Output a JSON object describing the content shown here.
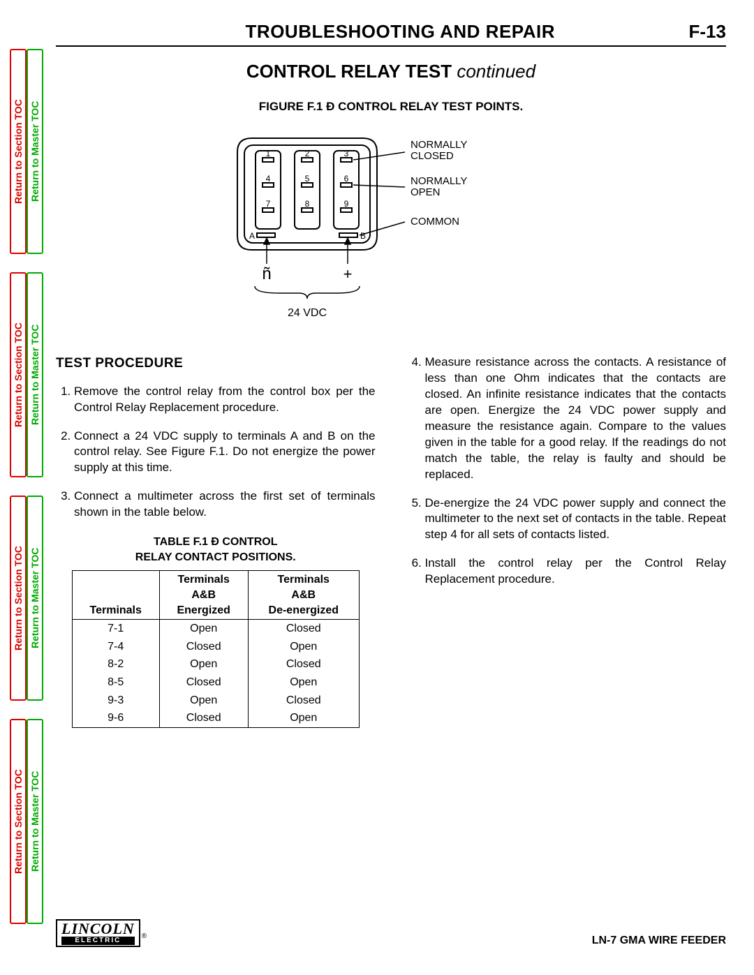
{
  "sidebar": {
    "section_toc": "Return to Section TOC",
    "master_toc": "Return to Master TOC"
  },
  "header": {
    "title": "TROUBLESHOOTING AND REPAIR",
    "page": "F-13"
  },
  "subtitle": {
    "main": "CONTROL RELAY TEST",
    "cont": "continued"
  },
  "figure": {
    "caption": "FIGURE F.1 Ð CONTROL RELAY TEST POINTS.",
    "labels": {
      "nc": "NORMALLY CLOSED",
      "no": "NORMALLY OPEN",
      "common": "COMMON",
      "a": "A",
      "b": "B",
      "minus": "ñ",
      "plus": "+",
      "vdc": "24  VDC",
      "pins": [
        "1",
        "2",
        "3",
        "4",
        "5",
        "6",
        "7",
        "8",
        "9"
      ]
    }
  },
  "procedure": {
    "heading": "TEST PROCEDURE",
    "steps_left": [
      "Remove the control relay from the control box per the Control Relay Replacement procedure.",
      "Connect a 24 VDC supply to terminals A and  B on the control relay. See Figure F.1. Do not energize the power supply at this time.",
      "Connect a multimeter across the first set of terminals shown in the table below."
    ],
    "steps_right": [
      "Measure resistance across the contacts. A resistance of less than one Ohm indicates that the contacts are closed. An infinite resistance indicates that the contacts are open. Energize the 24 VDC power supply and measure the resistance again. Compare to the values given in the table for a good relay. If the readings do not match the table, the relay is faulty and should be replaced.",
      "De-energize the 24 VDC power supply and connect the multimeter to the next set of contacts in the table. Repeat step 4 for all sets of contacts listed.",
      "Install the control relay per the Control Relay Replacement procedure."
    ]
  },
  "table": {
    "caption_line1": "TABLE F.1 Ð CONTROL",
    "caption_line2": "RELAY CONTACT POSITIONS.",
    "headers": {
      "col1": "Terminals",
      "col2_l1": "Terminals",
      "col2_l2": "A&B",
      "col2_l3": "Energized",
      "col3_l1": "Terminals",
      "col3_l2": "A&B",
      "col3_l3": "De-energized"
    },
    "rows": [
      {
        "t": "7-1",
        "e": "Open",
        "d": "Closed"
      },
      {
        "t": "7-4",
        "e": "Closed",
        "d": "Open"
      },
      {
        "t": "8-2",
        "e": "Open",
        "d": "Closed"
      },
      {
        "t": "8-5",
        "e": "Closed",
        "d": "Open"
      },
      {
        "t": "9-3",
        "e": "Open",
        "d": "Closed"
      },
      {
        "t": "9-6",
        "e": "Closed",
        "d": "Open"
      }
    ]
  },
  "footer": {
    "logo_top": "LINCOLN",
    "logo_bottom": "ELECTRIC",
    "reg": "®",
    "model": "LN-7 GMA WIRE FEEDER"
  }
}
